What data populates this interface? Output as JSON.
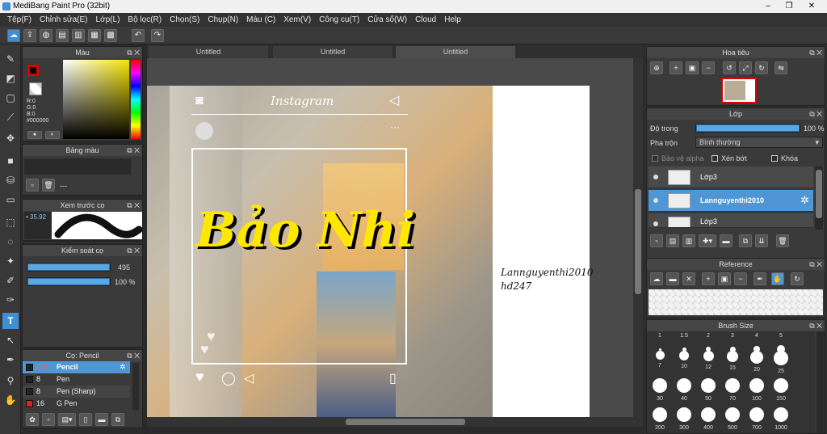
{
  "window": {
    "title": "MediBang Paint Pro (32bit)",
    "bg_tabs": [
      "",
      "",
      ""
    ]
  },
  "menu": [
    "Tệp(F)",
    "Chỉnh sửa(E)",
    "Lớp(L)",
    "Bộ lọc(R)",
    "Chọn(S)",
    "Chụp(N)",
    "Màu (C)",
    "Xem(V)",
    "Công cụ(T)",
    "Cửa số(W)",
    "Cloud",
    "Help"
  ],
  "doc_tabs": [
    "Untitled",
    "Untitled",
    "Untitled"
  ],
  "color_panel": {
    "title": "Màu",
    "r": "R:0",
    "g": "G:0",
    "b": "B:0",
    "hex": "#000000"
  },
  "palette_panel": {
    "title": "Bảng màu",
    "dash": "---"
  },
  "brush_preview": {
    "title": "Xem trước cọ",
    "size": "35.92"
  },
  "brush_control": {
    "title": "Kiểm soát cọ",
    "size": "495",
    "opacity": "100 %",
    "size_level": 1,
    "opacity_level": 1
  },
  "brush_list": {
    "title": "Cọ: Pencil",
    "items": [
      {
        "size": "495",
        "name": "Pencil",
        "color": "#222222",
        "selected": true
      },
      {
        "size": "8",
        "name": "Pen",
        "color": "#222222"
      },
      {
        "size": "8",
        "name": "Pen (Sharp)",
        "color": "#222222"
      },
      {
        "size": "16",
        "name": "G Pen",
        "color": "#e02020"
      }
    ]
  },
  "canvas": {
    "app_name": "Instagram",
    "title_text": "Bảo Nhi",
    "side_line1": "Lannguyenthi2010",
    "side_line2": "hd247"
  },
  "navigator": {
    "title": "Hoa tiêu"
  },
  "layers": {
    "title": "Lớp",
    "opacity_label": "Độ trong",
    "opacity_value": "100 %",
    "opacity_level": 1,
    "blend_label": "Pha trộn",
    "blend_value": "Bình thường",
    "protect_alpha": "Bảo vệ alpha",
    "clipping": "Xén bớt",
    "lock": "Khóa",
    "items": [
      {
        "name": "Lớp3",
        "selected": false
      },
      {
        "name": "Lannguyenthi2010",
        "selected": true
      },
      {
        "name": "Lớp3",
        "selected": false
      }
    ]
  },
  "reference": {
    "title": "Reference"
  },
  "brush_size": {
    "title": "Brush Size",
    "rows": [
      [
        "1",
        "1.5",
        "2",
        "3",
        "4",
        "5"
      ],
      [
        "7",
        "10",
        "12",
        "15",
        "20",
        "25"
      ],
      [
        "30",
        "40",
        "50",
        "70",
        "100",
        "150"
      ],
      [
        "200",
        "300",
        "400",
        "500",
        "700",
        "1000"
      ]
    ]
  }
}
